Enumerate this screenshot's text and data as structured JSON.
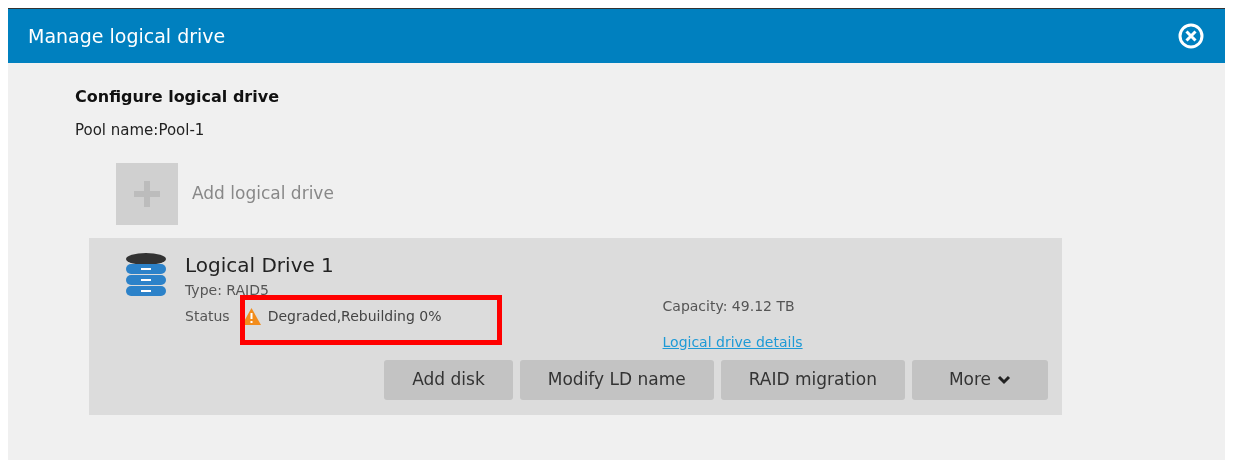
{
  "window": {
    "title": "Manage logical drive"
  },
  "section": {
    "title": "Configure logical drive",
    "pool": "Pool name:Pool-1"
  },
  "add_button": {
    "label": "Add logical drive",
    "disabled": true
  },
  "drive": {
    "name": "Logical Drive 1",
    "type": "Type: RAID5",
    "status_label": "Status",
    "status": "Degraded,Rebuilding 0%",
    "capacity": "Capacity: 49.12 TB",
    "details_link": "Logical drive details",
    "highlighted": true
  },
  "buttons": [
    {
      "label": "Add disk",
      "kind": "plain"
    },
    {
      "label": "Modify LD name",
      "kind": "plain"
    },
    {
      "label": "RAID migration",
      "kind": "plain"
    },
    {
      "label": "More",
      "kind": "dropdown"
    }
  ]
}
